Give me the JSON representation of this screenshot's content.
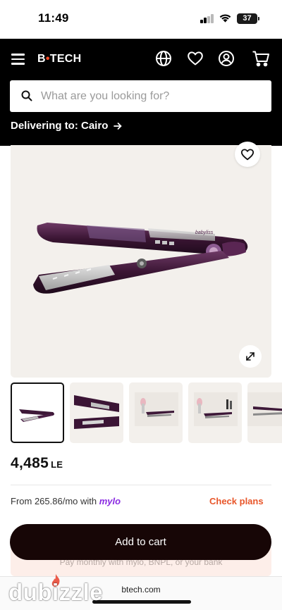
{
  "status": {
    "time": "11:49",
    "battery": "37"
  },
  "header": {
    "brand_part1": "B",
    "brand_dot": "•",
    "brand_part2": "TECH",
    "search_placeholder": "What are you looking for?",
    "delivering": "Delivering to: Cairo",
    "icons": [
      "menu-icon",
      "globe-icon",
      "heart-icon",
      "account-icon",
      "cart-icon"
    ],
    "brand_color": "#000000",
    "accent_color": "#ff4b26"
  },
  "product": {
    "price": "4,485",
    "currency": "LE",
    "installment_prefix": "From 265.86/mo with ",
    "installment_brand": "mylo",
    "check_plans": "Check plans",
    "add_to_cart": "Add to cart",
    "pay_strip": "Pay monthly with mylo, BNPL, or your bank",
    "image_brand": "babyliss",
    "thumbnail_count": 5,
    "active_thumbnail": 1
  },
  "browser": {
    "url": "btech.com"
  },
  "watermark": {
    "text": "dubizzle"
  }
}
